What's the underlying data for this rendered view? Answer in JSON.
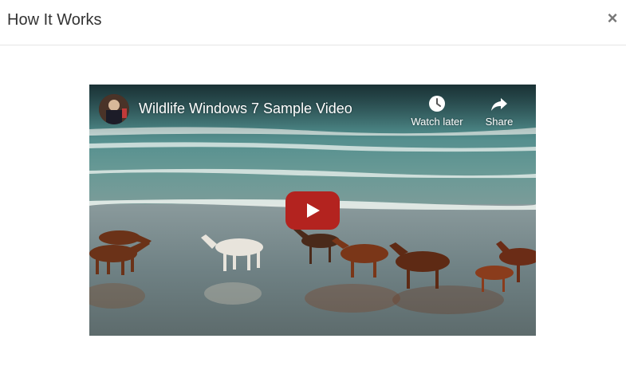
{
  "modal": {
    "title": "How It Works",
    "close_symbol": "×"
  },
  "video": {
    "title": "Wildlife Windows 7 Sample Video",
    "actions": {
      "watch_later": {
        "label": "Watch later",
        "icon": "clock-icon"
      },
      "share": {
        "label": "Share",
        "icon": "share-arrow-icon"
      }
    },
    "play_icon": "play-icon",
    "colors": {
      "play_red": "#b3231f",
      "sea": "#4e8284",
      "sand": "#6f8386"
    }
  }
}
